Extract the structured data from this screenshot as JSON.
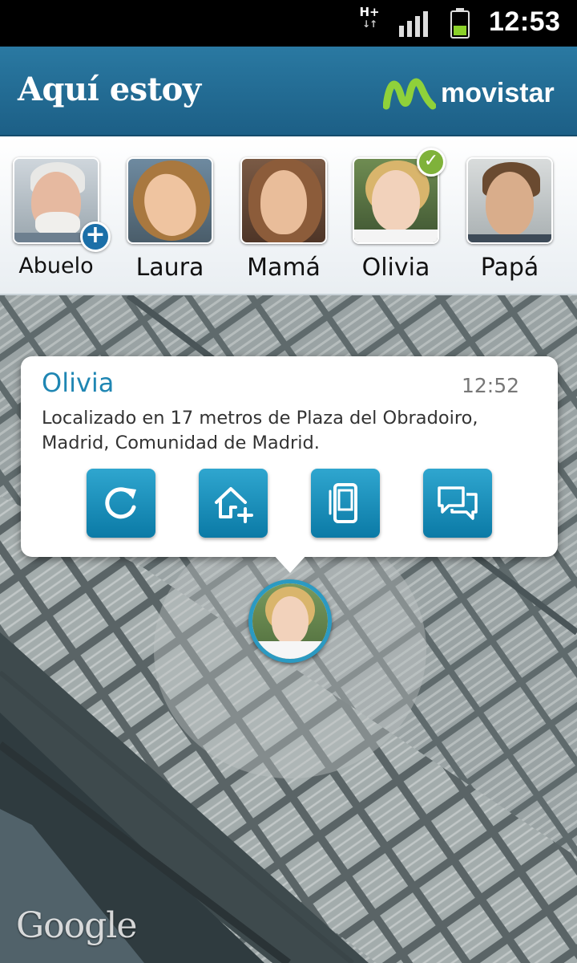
{
  "status_bar": {
    "network": "H+",
    "time": "12:53"
  },
  "app_bar": {
    "title": "Aquí estoy",
    "brand": "movistar"
  },
  "contacts": [
    {
      "name": "Abuelo"
    },
    {
      "name": "Laura"
    },
    {
      "name": "Mamá"
    },
    {
      "name": "Olivia"
    },
    {
      "name": "Papá"
    }
  ],
  "popup": {
    "name": "Olivia",
    "time": "12:52",
    "address": "Localizado en 17 metros de Plaza del Obradoiro, Madrid, Comunidad de Madrid.",
    "actions": [
      "refresh-icon",
      "home-add-icon",
      "phone-icon",
      "chat-icon"
    ]
  },
  "map": {
    "attribution": "Google"
  },
  "colors": {
    "app_bar": "#1c5f86",
    "accent": "#1f86b3",
    "action_button": "#0b7aa6",
    "check_badge": "#7fb23a"
  }
}
